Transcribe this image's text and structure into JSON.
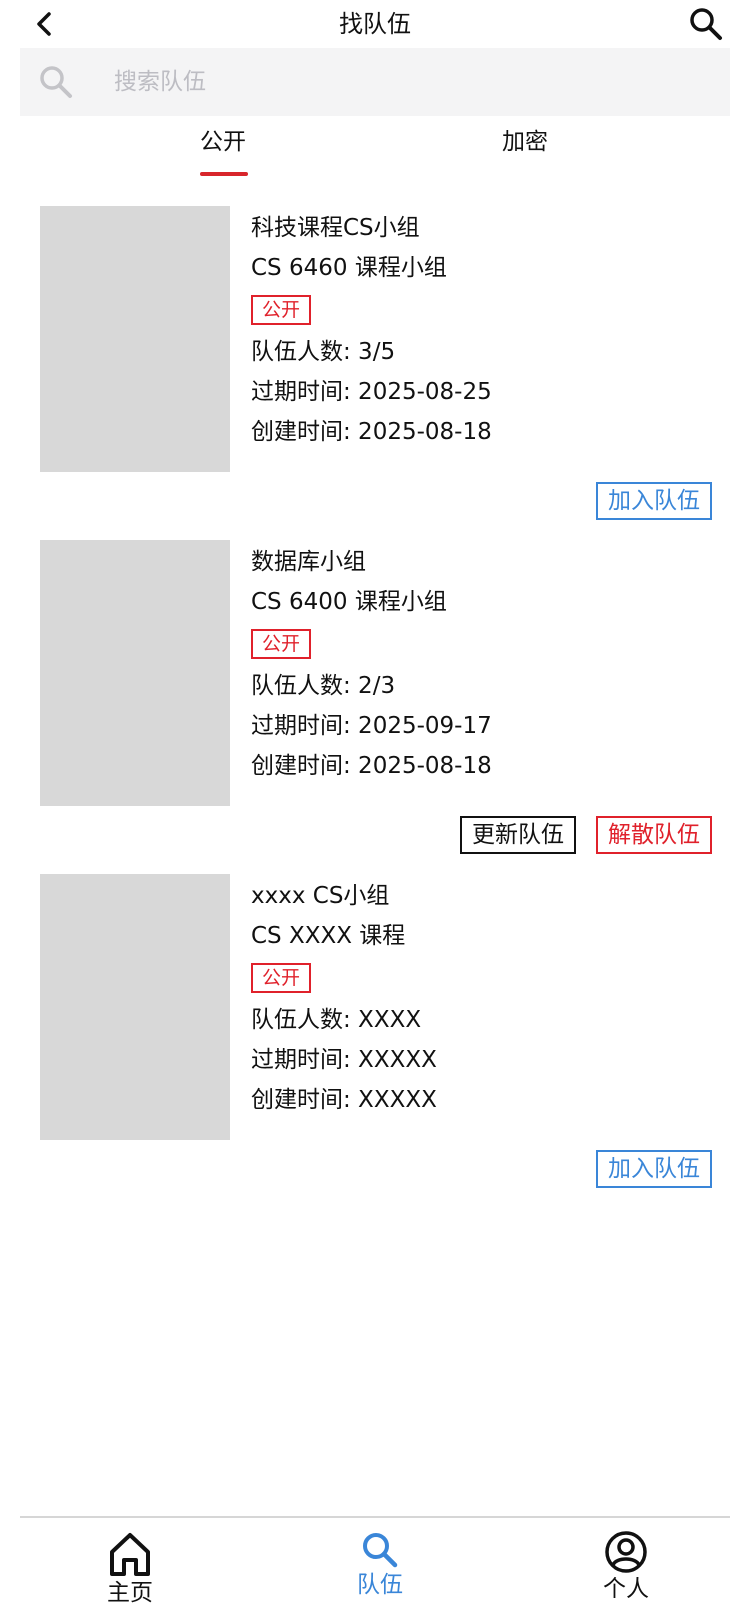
{
  "header": {
    "title": "找队伍"
  },
  "search": {
    "placeholder": "搜索队伍",
    "value": ""
  },
  "tabs": [
    {
      "label": "公开",
      "active": true
    },
    {
      "label": "加密",
      "active": false
    }
  ],
  "teams": [
    {
      "name": "科技课程CS小组",
      "course": "CS 6460 课程小组",
      "badge": "公开",
      "members": "队伍人数: 3/5",
      "expires": "过期时间: 2025-08-25",
      "created": "创建时间: 2025-08-18",
      "actions": [
        "加入队伍"
      ]
    },
    {
      "name": "数据库小组",
      "course": "CS 6400 课程小组",
      "badge": "公开",
      "members": "队伍人数: 2/3",
      "expires": "过期时间: 2025-09-17",
      "created": "创建时间: 2025-08-18",
      "actions": [
        "更新队伍",
        "解散队伍"
      ]
    },
    {
      "name": "xxxx CS小组",
      "course": "CS XXXX 课程",
      "badge": "公开",
      "members": "队伍人数: XXXX",
      "expires": "过期时间: XXXXX",
      "created": "创建时间: XXXXX",
      "actions": [
        "加入队伍"
      ]
    }
  ],
  "bottom_nav": [
    {
      "label": "主页",
      "icon": "home-icon",
      "active": false
    },
    {
      "label": "队伍",
      "icon": "search-icon",
      "active": true
    },
    {
      "label": "个人",
      "icon": "user-icon",
      "active": false
    }
  ],
  "colors": {
    "accent_blue": "#3a86d8",
    "accent_red": "#e0212b",
    "tab_underline": "#d8252b",
    "thumb_gray": "#d8d8d8",
    "search_bg": "#f4f4f5"
  }
}
